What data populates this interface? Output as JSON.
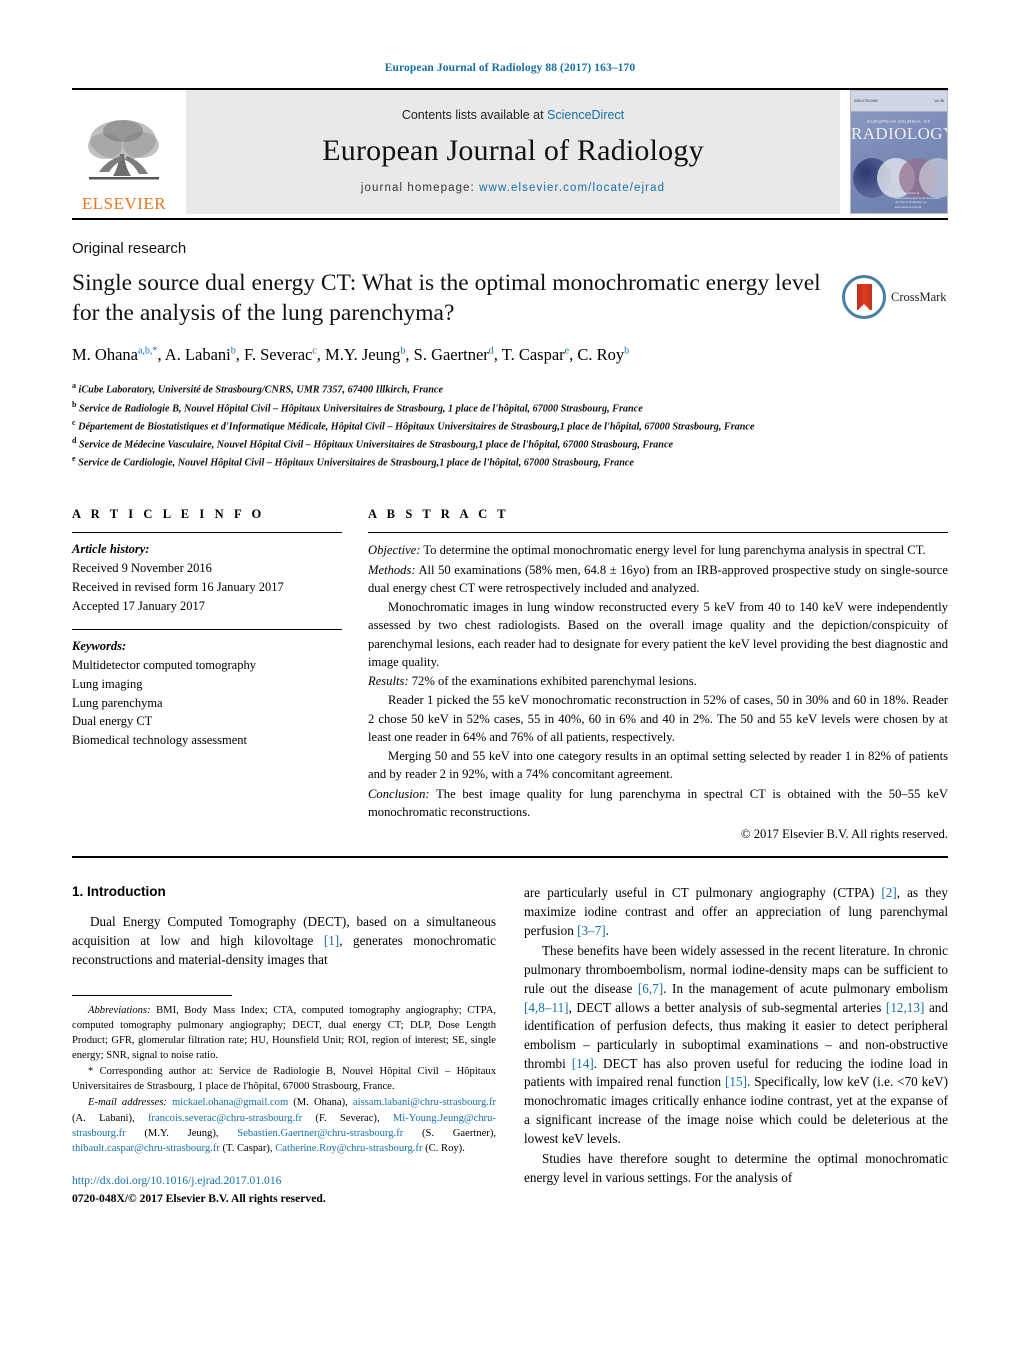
{
  "running_head": "European Journal of Radiology 88 (2017) 163–170",
  "masthead": {
    "contents_prefix": "Contents lists available at ",
    "contents_link": "ScienceDirect",
    "journal_title": "European Journal of Radiology",
    "homepage_prefix": "journal homepage: ",
    "homepage_url": "www.elsevier.com/locate/ejrad",
    "publisher": "ELSEVIER",
    "cover": {
      "journal_name": "EUROPEAN JOURNAL OF",
      "title_big": "RADIOLOGY",
      "top_left": "ISSN 0720-048X",
      "top_right": "Vol. 88",
      "footer": "Available online at\nwww.sciencedirect.com\nEuropean Journal of Radiology\nan international journal"
    },
    "accent_color": "#1670a8",
    "elsevier_orange": "#e87722"
  },
  "article": {
    "kind": "Original research",
    "title": "Single source dual energy CT: What is the optimal monochromatic energy level for the analysis of the lung parenchyma?",
    "crossmark_label": "CrossMark",
    "authors": [
      {
        "name": "M. Ohana",
        "marks": "a,b,*",
        "sep": ", "
      },
      {
        "name": "A. Labani",
        "marks": "b",
        "sep": ", "
      },
      {
        "name": "F. Severac",
        "marks": "c",
        "sep": ", "
      },
      {
        "name": "M.Y. Jeung",
        "marks": "b",
        "sep": ", "
      },
      {
        "name": "S. Gaertner",
        "marks": "d",
        "sep": ", "
      },
      {
        "name": "T. Caspar",
        "marks": "e",
        "sep": ", "
      },
      {
        "name": "C. Roy",
        "marks": "b",
        "sep": ""
      }
    ],
    "affiliations": [
      {
        "mark": "a",
        "text": "iCube Laboratory, Université de Strasbourg/CNRS, UMR 7357, 67400 Illkirch, France"
      },
      {
        "mark": "b",
        "text": "Service de Radiologie B, Nouvel Hôpital Civil – Hôpitaux Universitaires de Strasbourg, 1 place de l'hôpital, 67000 Strasbourg, France"
      },
      {
        "mark": "c",
        "text": "Département de Biostatistiques et d'Informatique Médicale, Hôpital Civil – Hôpitaux Universitaires de Strasbourg,1 place de l'hôpital, 67000 Strasbourg, France"
      },
      {
        "mark": "d",
        "text": "Service de Médecine Vasculaire, Nouvel Hôpital Civil – Hôpitaux Universitaires de Strasbourg,1 place de l'hôpital, 67000 Strasbourg, France"
      },
      {
        "mark": "e",
        "text": "Service de Cardiologie, Nouvel Hôpital Civil – Hôpitaux Universitaires de Strasbourg,1 place de l'hôpital, 67000 Strasbourg, France"
      }
    ]
  },
  "article_info": {
    "heading": "A R T I C L E   I N F O",
    "history_label": "Article history:",
    "history": [
      "Received 9 November 2016",
      "Received in revised form 16 January 2017",
      "Accepted 17 January 2017"
    ],
    "keywords_label": "Keywords:",
    "keywords": [
      "Multidetector computed tomography",
      "Lung imaging",
      "Lung parenchyma",
      "Dual energy CT",
      "Biomedical technology assessment"
    ]
  },
  "abstract": {
    "heading": "A B S T R A C T",
    "objective_label": "Objective:",
    "objective_text": " To determine the optimal monochromatic energy level for lung parenchyma analysis in spectral CT.",
    "methods_label": "Methods:",
    "methods_text": " All 50 examinations (58% men, 64.8 ± 16yo) from an IRB-approved prospective study on single-source dual energy chest CT were retrospectively included and analyzed.",
    "methods_p2": "Monochromatic images in lung window reconstructed every 5 keV from 40 to 140 keV were independently assessed by two chest radiologists. Based on the overall image quality and the depiction/conspicuity of parenchymal lesions, each reader had to designate for every patient the keV level providing the best diagnostic and image quality.",
    "results_label": "Results:",
    "results_text": " 72% of the examinations exhibited parenchymal lesions.",
    "results_p2": "Reader 1 picked the 55 keV monochromatic reconstruction in 52% of cases, 50 in 30% and 60 in 18%. Reader 2 chose 50 keV in 52% cases, 55 in 40%, 60 in 6% and 40 in 2%. The 50 and 55 keV levels were chosen by at least one reader in 64% and 76% of all patients, respectively.",
    "results_p3": "Merging 50 and 55 keV into one category results in an optimal setting selected by reader 1 in 82% of patients and by reader 2 in 92%, with a 74% concomitant agreement.",
    "conclusion_label": "Conclusion:",
    "conclusion_text": " The best image quality for lung parenchyma in spectral CT is obtained with the 50–55 keV monochromatic reconstructions.",
    "copyright": "© 2017 Elsevier B.V. All rights reserved."
  },
  "body": {
    "section_number_title": "1.  Introduction",
    "left_p1_a": "Dual Energy Computed Tomography (DECT), based on a simultaneous acquisition at low and high kilovoltage ",
    "left_p1_ref": "[1]",
    "left_p1_b": ", generates monochromatic reconstructions and material-density images that",
    "right_p1_a": "are particularly useful in CT pulmonary angiography (CTPA) ",
    "right_p1_ref1": "[2]",
    "right_p1_b": ", as they maximize iodine contrast and offer an appreciation of lung parenchymal perfusion ",
    "right_p1_ref2": "[3–7]",
    "right_p1_c": ".",
    "right_p2_a": "These benefits have been widely assessed in the recent literature. In chronic pulmonary thromboembolism, normal iodine-density maps can be sufficient to rule out the disease ",
    "right_p2_ref1": "[6,7]",
    "right_p2_b": ". In the management of acute pulmonary embolism ",
    "right_p2_ref2": "[4,8–11]",
    "right_p2_c": ", DECT allows a better analysis of sub-segmental arteries ",
    "right_p2_ref3": "[12,13]",
    "right_p2_d": " and identification of perfusion defects, thus making it easier to detect peripheral embolism – particularly in suboptimal examinations – and non-obstructive thrombi ",
    "right_p2_ref4": "[14]",
    "right_p2_e": ". DECT has also proven useful for reducing the iodine load in patients with impaired renal function ",
    "right_p2_ref5": "[15]",
    "right_p2_f": ". Specifically, low keV (i.e. <70 keV) monochromatic images critically enhance iodine contrast, yet at the expanse of a significant increase of the image noise which could be deleterious at the lowest keV levels.",
    "right_p3": "Studies have therefore sought to determine the optimal monochromatic energy level in various settings. For the analysis of"
  },
  "footnotes": {
    "abbrev_label": "Abbreviations:",
    "abbrev_text": "  BMI, Body Mass Index; CTA, computed tomography angiography; CTPA, computed tomography pulmonary angiography; DECT, dual energy CT; DLP, Dose Length Product; GFR, glomerular filtration rate; HU, Hounsfield Unit; ROI, region of interest; SE, single energy; SNR, signal to noise ratio.",
    "corresponding": "* Corresponding author at: Service de Radiologie B, Nouvel Hôpital Civil – Hôpitaux Universitaires de Strasbourg, 1 place de l'hôpital, 67000 Strasbourg, France.",
    "email_label": "E-mail addresses:",
    "emails": [
      {
        "mail": "mickael.ohana@gmail.com",
        "who": " (M. Ohana), "
      },
      {
        "mail": "aissam.labani@chru-strasbourg.fr",
        "who": " (A. Labani), "
      },
      {
        "mail": "francois.severac@chru-strasbourg.fr",
        "who": " (F. Severac), "
      },
      {
        "mail": "Mi-Young.Jeung@chru-strasbourg.fr",
        "who": " (M.Y. Jeung), "
      },
      {
        "mail": "Sebastien.Gaertner@chru-strasbourg.fr",
        "who": " (S. Gaertner), "
      },
      {
        "mail": "thibault.caspar@chru-strasbourg.fr",
        "who": " (T. Caspar), "
      },
      {
        "mail": "Catherine.Roy@chru-strasbourg.fr",
        "who": " (C. Roy)."
      }
    ],
    "doi": "http://dx.doi.org/10.1016/j.ejrad.2017.01.016",
    "issn_line": "0720-048X/© 2017 Elsevier B.V. All rights reserved."
  }
}
